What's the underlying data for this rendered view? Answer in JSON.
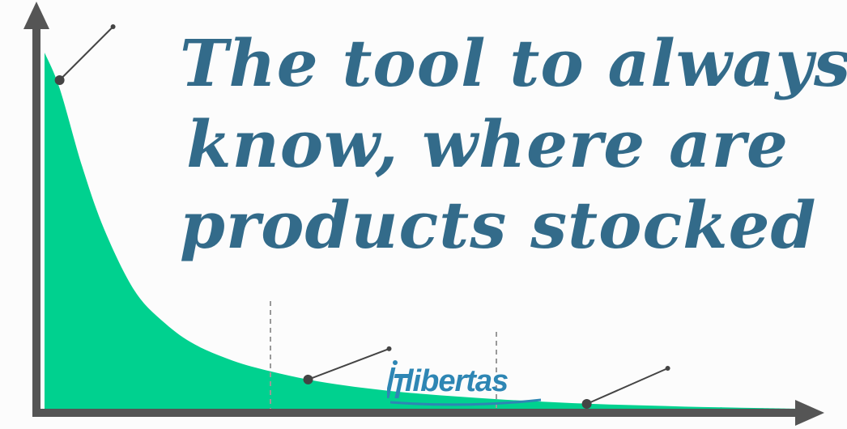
{
  "headline": {
    "lines": [
      "The tool to always",
      "know, where are",
      "products stocked"
    ]
  },
  "logo": {
    "text": "IT libertas",
    "mark_text": "IT",
    "word_text": "libertas",
    "color": "#2e86b4"
  },
  "colors": {
    "area_fill": "#00d18f",
    "axis": "#555555",
    "headline": "#336b8a",
    "divider": "#999999",
    "callout": "#444444"
  },
  "chart_data": {
    "type": "area",
    "title": "",
    "xlabel": "",
    "ylabel": "",
    "curve": "long-tail decay",
    "series": [
      {
        "x": [
          0,
          0.02,
          0.05,
          0.08,
          0.12,
          0.16,
          0.2,
          0.25,
          0.3,
          0.35,
          0.4,
          0.45,
          0.5,
          0.55,
          0.6,
          0.65,
          0.7,
          0.75,
          0.8,
          0.85,
          0.9,
          0.95,
          1.0
        ],
        "y": [
          1.0,
          0.9,
          0.68,
          0.5,
          0.33,
          0.24,
          0.18,
          0.135,
          0.105,
          0.082,
          0.065,
          0.052,
          0.042,
          0.034,
          0.027,
          0.021,
          0.016,
          0.012,
          0.009,
          0.006,
          0.004,
          0.002,
          0.0
        ]
      }
    ],
    "dividers_x": [
      0.3,
      0.6
    ],
    "callout_points_x": [
      0.02,
      0.35,
      0.72
    ],
    "xlim": [
      0,
      1
    ],
    "ylim": [
      0,
      1
    ],
    "grid": false,
    "legend": "none"
  }
}
